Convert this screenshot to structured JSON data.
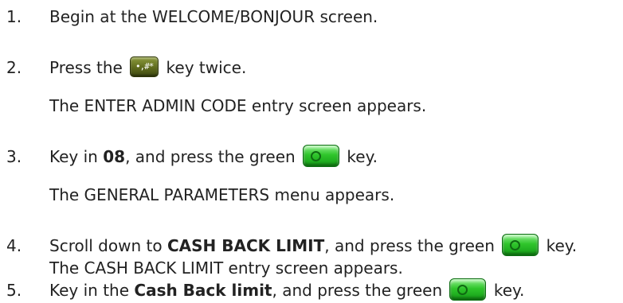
{
  "steps": [
    {
      "number": "1.",
      "parts": [
        "Begin at the WELCOME/BONJOUR screen."
      ]
    },
    {
      "number": "2.",
      "before_key": "Press the",
      "key_icon": "hash-key-icon",
      "key_label": "•,#*",
      "after_key": "key twice.",
      "result": "The ENTER ADMIN CODE entry screen appears."
    },
    {
      "number": "3.",
      "before_bold": "Key in",
      "bold": "08",
      "after_bold": ", and press the green",
      "key_icon": "green-key-icon",
      "after_key": "key.",
      "result": "The GENERAL PARAMETERS menu appears."
    },
    {
      "number": "4.",
      "before_bold": "Scroll down to",
      "bold": "CASH BACK LIMIT",
      "after_bold": ", and press the green",
      "key_icon": "green-key-icon",
      "after_key": "key.",
      "result": "The CASH BACK LIMIT entry screen appears."
    },
    {
      "number": "5.",
      "before_bold": "Key in the",
      "bold": "Cash Back limit",
      "after_bold": ", and press the green",
      "key_icon": "green-key-icon",
      "after_key": "key."
    }
  ],
  "colors": {
    "text": "#222222",
    "hash_key": "#5f6b1d",
    "green_key": "#2fc52b"
  }
}
